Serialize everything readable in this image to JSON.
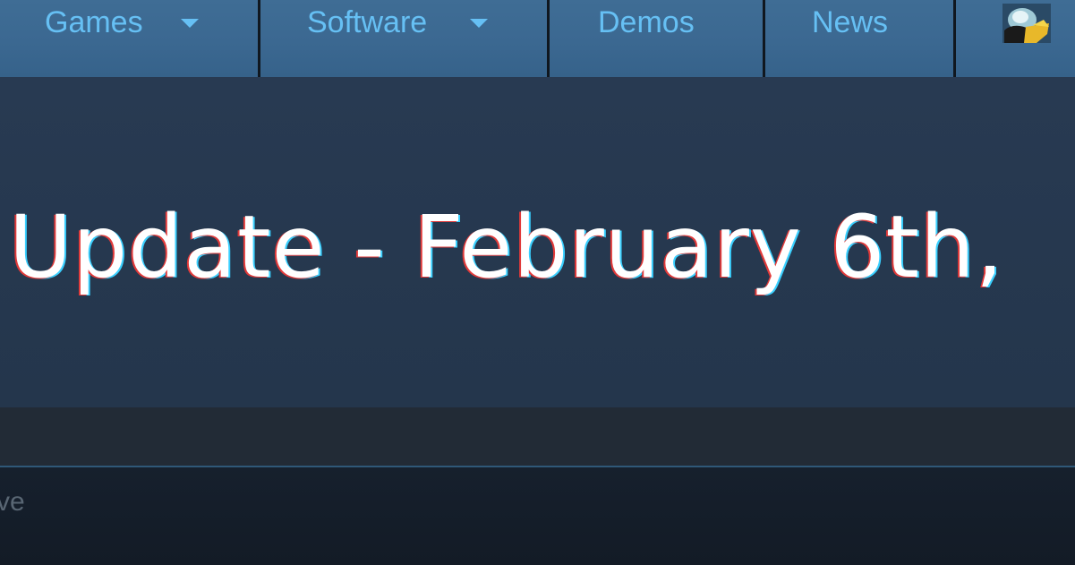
{
  "nav": {
    "items": [
      {
        "label": "Games",
        "dropdown": true
      },
      {
        "label": "Software",
        "dropdown": true
      },
      {
        "label": "Demos",
        "dropdown": false
      },
      {
        "label": "News",
        "dropdown": false
      }
    ],
    "avatar_icon": "user-avatar-icon"
  },
  "banner": {
    "title": "Update - February 6th,"
  },
  "content": {
    "subtext": "ve",
    "body_text": ""
  },
  "colors": {
    "nav_bg": "#3b6891",
    "nav_text": "#66c0f4",
    "banner_bg": "#26384f",
    "title_text": "#ffffff",
    "page_bg": "#1b2838"
  }
}
